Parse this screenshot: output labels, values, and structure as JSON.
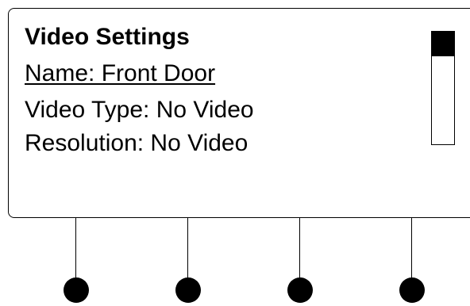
{
  "screen": {
    "title": "Video Settings",
    "items": [
      {
        "label": "Name: Front Door",
        "selected": true
      },
      {
        "label": "Video Type: No Video",
        "selected": false
      },
      {
        "label": "Resolution: No Video",
        "selected": false
      }
    ],
    "scrollbar": {
      "position_fraction": 0,
      "thumb_fraction": 0.22
    }
  },
  "softkeys": [
    {
      "name": "softkey-1"
    },
    {
      "name": "softkey-2"
    },
    {
      "name": "softkey-3"
    },
    {
      "name": "softkey-4"
    }
  ],
  "colors": {
    "foreground": "#000000",
    "background": "#ffffff"
  }
}
